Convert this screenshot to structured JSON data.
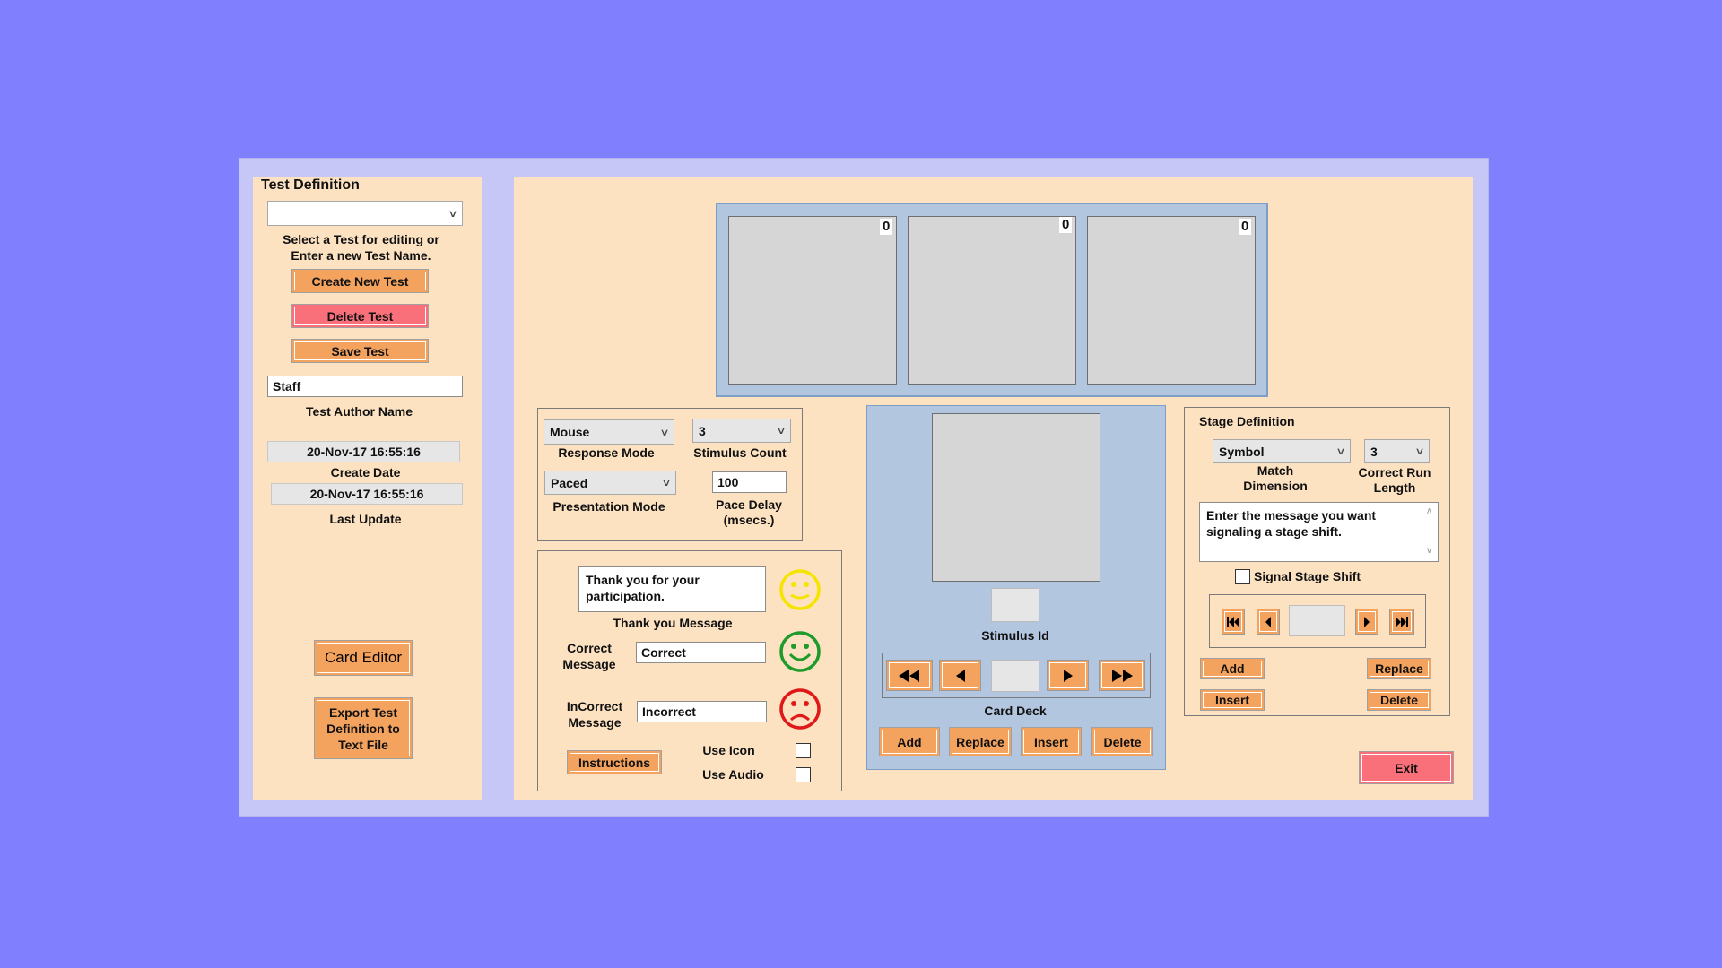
{
  "left_panel": {
    "title": "Test Definition",
    "test_select_value": "",
    "select_hint_line1": "Select a Test for editing or",
    "select_hint_line2": "Enter a new Test Name.",
    "create_new_test_label": "Create New Test",
    "delete_test_label": "Delete Test",
    "save_test_label": "Save Test",
    "author_value": "Staff",
    "author_label": "Test Author Name",
    "create_date_value": "20-Nov-17 16:55:16",
    "create_date_label": "Create Date",
    "last_update_value": "20-Nov-17 16:55:16",
    "last_update_label": "Last Update",
    "card_editor_label": "Card Editor",
    "export_line1": "Export Test",
    "export_line2": "Definition to",
    "export_line3": "Text File"
  },
  "cards": [
    {
      "count": "0"
    },
    {
      "count": "0"
    },
    {
      "count": "0"
    }
  ],
  "modes": {
    "response_mode_value": "Mouse",
    "response_mode_label": "Response Mode",
    "stimulus_count_value": "3",
    "stimulus_count_label": "Stimulus Count",
    "presentation_mode_value": "Paced",
    "presentation_mode_label": "Presentation Mode",
    "pace_delay_value": "100",
    "pace_delay_line1": "Pace Delay",
    "pace_delay_line2": "(msecs.)"
  },
  "messages": {
    "thank_you_line1": "Thank you for your",
    "thank_you_line2": "participation.",
    "thank_you_label": "Thank you Message",
    "correct_label_line1": "Correct",
    "correct_label_line2": "Message",
    "correct_value": "Correct",
    "incorrect_label_line1": "InCorrect",
    "incorrect_label_line2": "Message",
    "incorrect_value": "Incorrect",
    "instructions_label": "Instructions",
    "use_icon_label": "Use Icon",
    "use_audio_label": "Use Audio"
  },
  "deck": {
    "stimulus_id_label": "Stimulus Id",
    "card_deck_label": "Card Deck",
    "add_label": "Add",
    "replace_label": "Replace",
    "insert_label": "Insert",
    "delete_label": "Delete"
  },
  "stage": {
    "title": "Stage Definition",
    "match_dimension_value": "Symbol",
    "match_dimension_line1": "Match",
    "match_dimension_line2": "Dimension",
    "correct_run_value": "3",
    "correct_run_line1": "Correct Run",
    "correct_run_line2": "Length",
    "message_text_line1": "Enter the message you want",
    "message_text_line2": "signaling a stage shift.",
    "signal_label": "Signal Stage Shift",
    "add_label": "Add",
    "replace_label": "Replace",
    "insert_label": "Insert",
    "delete_label": "Delete"
  },
  "exit_label": "Exit",
  "colors": {
    "background": "#8080ff",
    "panel": "#fde2c2",
    "button": "#f4a35f",
    "danger_button": "#f9707a",
    "smiley_neutral": "#f5e400",
    "smiley_correct": "#1e9b2a",
    "smiley_incorrect": "#e01818"
  },
  "icons": {
    "neutral": "neutral-face-icon",
    "correct": "smile-face-icon",
    "incorrect": "sad-face-icon"
  }
}
